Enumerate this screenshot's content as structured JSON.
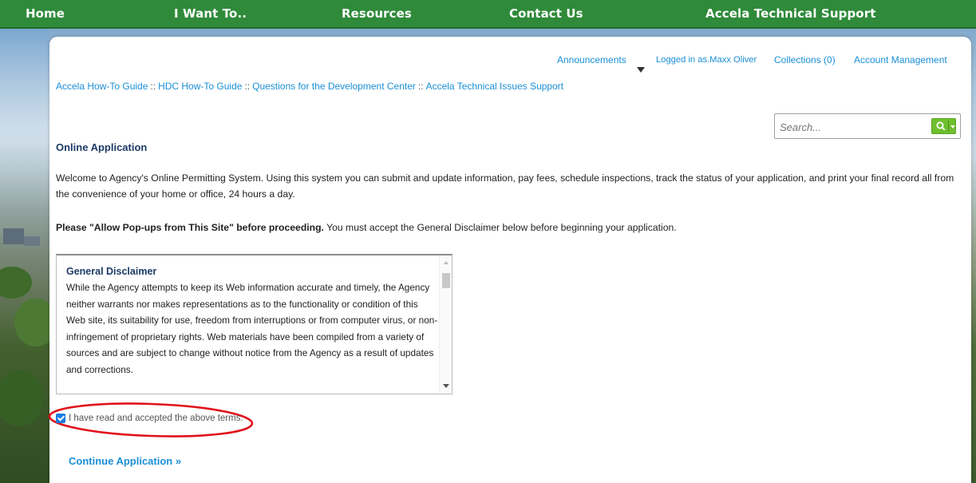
{
  "nav": {
    "items": [
      "Home",
      "I Want To..",
      "Resources",
      "Contact Us",
      "Accela Technical Support"
    ]
  },
  "utility": {
    "announcements": "Announcements",
    "logged_in": "Logged in as.Maxx Oliver",
    "collections": "Collections (0)",
    "account": "Account Management"
  },
  "breadcrumb": {
    "items": [
      "Accela How-To Guide",
      "HDC How-To Guide",
      "Questions for the Development Center",
      "Accela Technical Issues Support"
    ],
    "separators": [
      "::",
      "::",
      "::"
    ]
  },
  "search": {
    "placeholder": "Search..."
  },
  "page": {
    "title": "Online Application",
    "welcome": "Welcome to Agency's Online Permitting System. Using this system you can submit and update information, pay fees, schedule inspections, track the status of your application, and print your final record all from the convenience of your home or office, 24 hours a day.",
    "popup_bold": "Please \"Allow Pop-ups from This Site\" before proceeding.",
    "popup_rest": " You must accept the General Disclaimer below before beginning your application."
  },
  "disclaimer": {
    "title": "General Disclaimer",
    "body": "While the Agency attempts to keep its Web information accurate and timely, the Agency neither warrants nor makes representations as to the functionality or condition of this Web site, its suitability for use, freedom from interruptions or from computer virus, or non-infringement of proprietary rights. Web materials have been compiled from a variety of sources and are subject to change without notice from the Agency as a result of updates and corrections."
  },
  "accept": {
    "label": "I have read and accepted the above terms.",
    "checked": true
  },
  "continue": {
    "label": "Continue Application »"
  },
  "colors": {
    "nav_green": "#2f8a3a",
    "link_blue": "#1a8fd6",
    "title_navy": "#1d3b66",
    "search_green": "#6fbf2e",
    "annotation_red": "#e0121c"
  },
  "icons": {
    "search": "search-icon",
    "announce_caret": "caret-down-icon",
    "checkbox": "checkbox-checked-icon"
  }
}
